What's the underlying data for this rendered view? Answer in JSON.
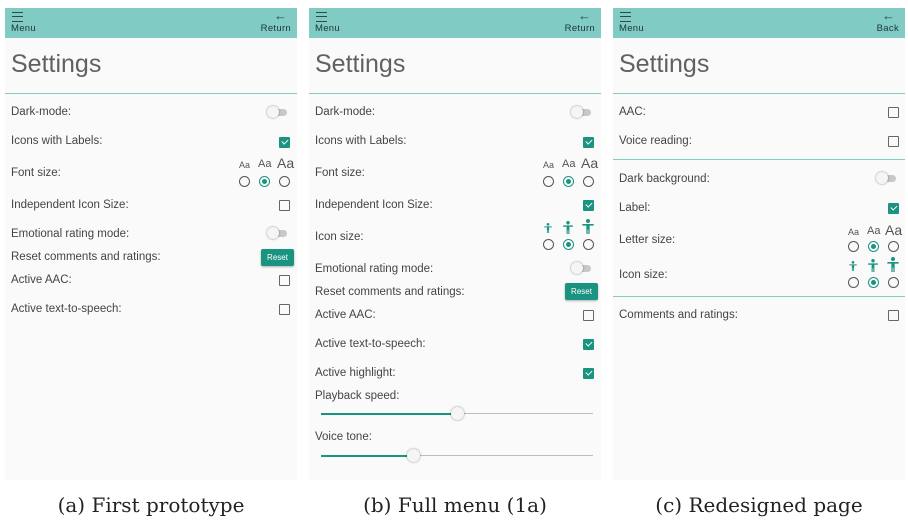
{
  "panels": [
    {
      "menu_label": "Menu",
      "back_label": "Return",
      "title": "Settings",
      "rows": {
        "dark_mode": "Dark-mode:",
        "icons_labels": "Icons with Labels:",
        "font_size": "Font size:",
        "independent_icon": "Independent Icon Size:",
        "emotional": "Emotional rating mode:",
        "reset_comments": "Reset comments and ratings:",
        "active_aac": "Active AAC:",
        "active_tts": "Active text-to-speech:"
      },
      "size_sample": "Aa",
      "reset_label": "Reset",
      "caption": "(a) First prototype"
    },
    {
      "menu_label": "Menu",
      "back_label": "Return",
      "title": "Settings",
      "rows": {
        "dark_mode": "Dark-mode:",
        "icons_labels": "Icons with Labels:",
        "font_size": "Font size:",
        "independent_icon": "Independent Icon Size:",
        "icon_size": "Icon size:",
        "emotional": "Emotional rating mode:",
        "reset_comments": "Reset comments and ratings:",
        "active_aac": "Active AAC:",
        "active_tts": "Active text-to-speech:",
        "active_highlight": "Active highlight:",
        "playback_speed": "Playback speed:",
        "voice_tone": "Voice tone:"
      },
      "size_sample": "Aa",
      "reset_label": "Reset",
      "playback_speed_value": 0.5,
      "voice_tone_value": 0.34,
      "caption": "(b) Full menu (1a)"
    },
    {
      "menu_label": "Menu",
      "back_label": "Back",
      "title": "Settings",
      "rows": {
        "aac": "AAC:",
        "voice_reading": "Voice reading:",
        "dark_background": "Dark background:",
        "label": "Label:",
        "letter_size": "Letter size:",
        "icon_size": "Icon size:",
        "comments_ratings": "Comments and ratings:"
      },
      "size_sample": "Aa",
      "caption": "(c) Redesigned page"
    }
  ],
  "colors": {
    "accent": "#1a9380",
    "topbar": "#80cbc4"
  },
  "icons": {
    "menu": "hamburger-icon",
    "back": "arrow-left-icon",
    "person": "person-icon"
  }
}
